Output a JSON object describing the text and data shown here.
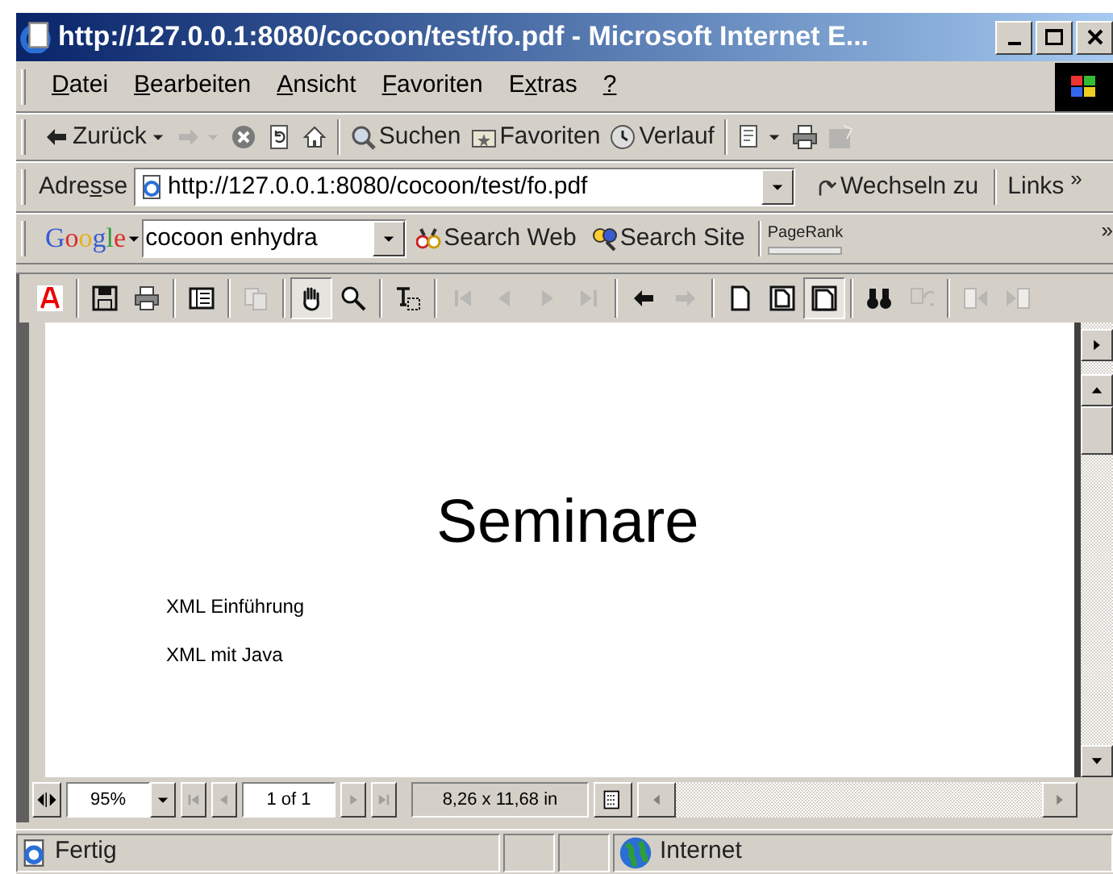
{
  "window": {
    "title": "http://127.0.0.1:8080/cocoon/test/fo.pdf - Microsoft Internet E..."
  },
  "menu": [
    {
      "key": "D",
      "after": "atei"
    },
    {
      "key": "B",
      "after": "earbeiten"
    },
    {
      "key": "A",
      "after": "nsicht"
    },
    {
      "key": "F",
      "after": "avoriten"
    },
    {
      "before": "E",
      "key": "x",
      "after": "tras"
    },
    {
      "key": "?"
    }
  ],
  "nav_toolbar": {
    "groups": [
      [
        {
          "kind": "back",
          "label": "Zurück",
          "dropdown": true,
          "disabled": false
        },
        {
          "kind": "forward",
          "dropdown": true,
          "disabled": true
        },
        {
          "kind": "stop",
          "dropdown": false,
          "disabled": false
        },
        {
          "kind": "refresh",
          "dropdown": false,
          "disabled": false
        },
        {
          "kind": "home",
          "dropdown": false,
          "disabled": false
        }
      ],
      [
        {
          "kind": "search",
          "label": "Suchen",
          "dropdown": false,
          "disabled": false
        },
        {
          "kind": "favorites",
          "label": "Favoriten",
          "dropdown": false,
          "disabled": false
        },
        {
          "kind": "history",
          "label": "Verlauf",
          "dropdown": false,
          "disabled": false
        }
      ],
      [
        {
          "kind": "mail",
          "dropdown": true,
          "disabled": false
        },
        {
          "kind": "print",
          "dropdown": false,
          "disabled": false
        },
        {
          "kind": "edit",
          "dropdown": false,
          "disabled": true
        }
      ]
    ]
  },
  "address_bar": {
    "label": {
      "before": "Adre",
      "key": "s",
      "after": "se"
    },
    "value": "http://127.0.0.1:8080/cocoon/test/fo.pdf",
    "go": "Wechseln zu",
    "links": "Links",
    "more": "»"
  },
  "google_bar": {
    "logo": "Google",
    "query": "cocoon enhydra",
    "buttons": [
      {
        "kind": "search_web",
        "label": "Search Web"
      },
      {
        "kind": "search_site",
        "label": "Search Site"
      }
    ],
    "pagerank": {
      "label": "PageRank",
      "level": 0
    },
    "more": "»"
  },
  "pdf_toolbar": {
    "groups": [
      [
        {
          "kind": "acrobat",
          "disabled": false,
          "selected": false
        }
      ],
      [
        {
          "kind": "save",
          "disabled": false,
          "selected": false
        },
        {
          "kind": "print",
          "disabled": false,
          "selected": false
        }
      ],
      [
        {
          "kind": "thumbnails",
          "disabled": false,
          "selected": false
        }
      ],
      [
        {
          "kind": "copy",
          "disabled": true,
          "selected": false
        }
      ],
      [
        {
          "kind": "hand",
          "disabled": false,
          "selected": true
        },
        {
          "kind": "zoom",
          "disabled": false,
          "selected": false
        }
      ],
      [
        {
          "kind": "text_select",
          "disabled": false,
          "selected": false
        }
      ],
      [
        {
          "kind": "first",
          "disabled": true,
          "selected": false
        },
        {
          "kind": "prev",
          "disabled": true,
          "selected": false
        },
        {
          "kind": "next",
          "disabled": true,
          "selected": false
        },
        {
          "kind": "last",
          "disabled": true,
          "selected": false
        }
      ],
      [
        {
          "kind": "back",
          "disabled": false,
          "selected": false
        },
        {
          "kind": "forward",
          "disabled": true,
          "selected": false
        }
      ],
      [
        {
          "kind": "actual_size",
          "disabled": false,
          "selected": false
        },
        {
          "kind": "fit_page",
          "disabled": false,
          "selected": false
        },
        {
          "kind": "fit_width",
          "disabled": false,
          "selected": true
        }
      ],
      [
        {
          "kind": "find",
          "disabled": false,
          "selected": false
        },
        {
          "kind": "reflow",
          "disabled": true,
          "selected": false
        }
      ],
      [
        {
          "kind": "spread_left",
          "disabled": true,
          "selected": false
        },
        {
          "kind": "spread_right",
          "disabled": true,
          "selected": false
        }
      ]
    ]
  },
  "document": {
    "title": "Seminare",
    "lines": [
      "XML Einführung",
      "XML mit Java"
    ]
  },
  "pdf_statusbar": {
    "zoom": "95%",
    "page": "1 of 1",
    "page_size": "8,26 x 11,68 in"
  },
  "status_bar": {
    "text": "Fertig",
    "zone": "Internet"
  }
}
